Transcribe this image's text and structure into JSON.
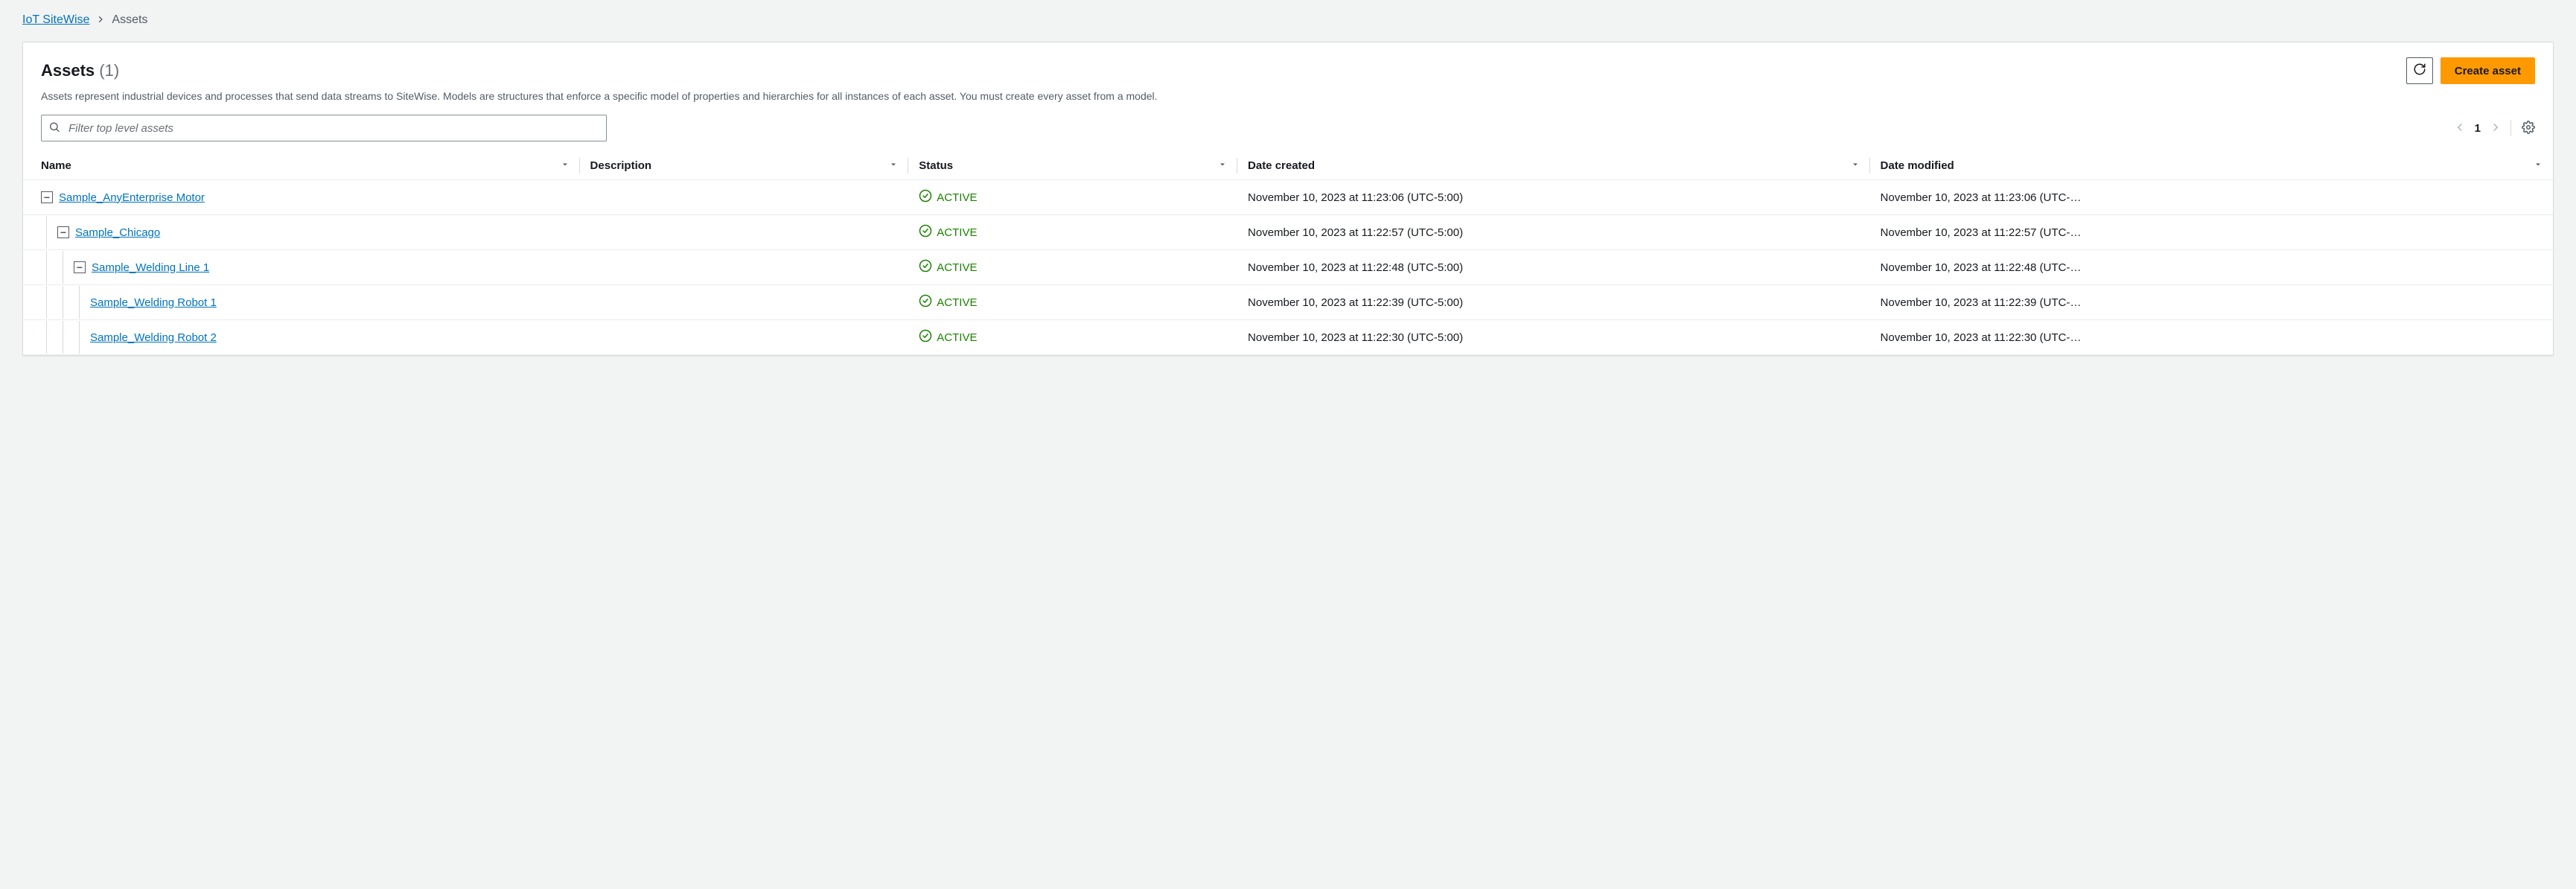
{
  "breadcrumb": {
    "root": "IoT SiteWise",
    "current": "Assets"
  },
  "header": {
    "title": "Assets",
    "count": "(1)",
    "description": "Assets represent industrial devices and processes that send data streams to SiteWise. Models are structures that enforce a specific model of properties and hierarchies for all instances of each asset. You must create every asset from a model.",
    "create_label": "Create asset"
  },
  "search": {
    "placeholder": "Filter top level assets"
  },
  "pager": {
    "page": "1"
  },
  "columns": {
    "name": "Name",
    "description": "Description",
    "status": "Status",
    "date_created": "Date created",
    "date_modified": "Date modified"
  },
  "status_text": "ACTIVE",
  "rows": [
    {
      "indent": 0,
      "expandable": true,
      "name": "Sample_AnyEnterprise Motor",
      "description": "",
      "created": "November 10, 2023 at 11:23:06 (UTC-5:00)",
      "modified": "November 10, 2023 at 11:23:06 (UTC-…"
    },
    {
      "indent": 1,
      "expandable": true,
      "name": "Sample_Chicago",
      "description": "",
      "created": "November 10, 2023 at 11:22:57 (UTC-5:00)",
      "modified": "November 10, 2023 at 11:22:57 (UTC-…"
    },
    {
      "indent": 2,
      "expandable": true,
      "name": "Sample_Welding Line 1",
      "description": "",
      "created": "November 10, 2023 at 11:22:48 (UTC-5:00)",
      "modified": "November 10, 2023 at 11:22:48 (UTC-…"
    },
    {
      "indent": 3,
      "expandable": false,
      "name": "Sample_Welding Robot 1",
      "description": "",
      "created": "November 10, 2023 at 11:22:39 (UTC-5:00)",
      "modified": "November 10, 2023 at 11:22:39 (UTC-…"
    },
    {
      "indent": 3,
      "expandable": false,
      "name": "Sample_Welding Robot 2",
      "description": "",
      "created": "November 10, 2023 at 11:22:30 (UTC-5:00)",
      "modified": "November 10, 2023 at 11:22:30 (UTC-…"
    }
  ]
}
